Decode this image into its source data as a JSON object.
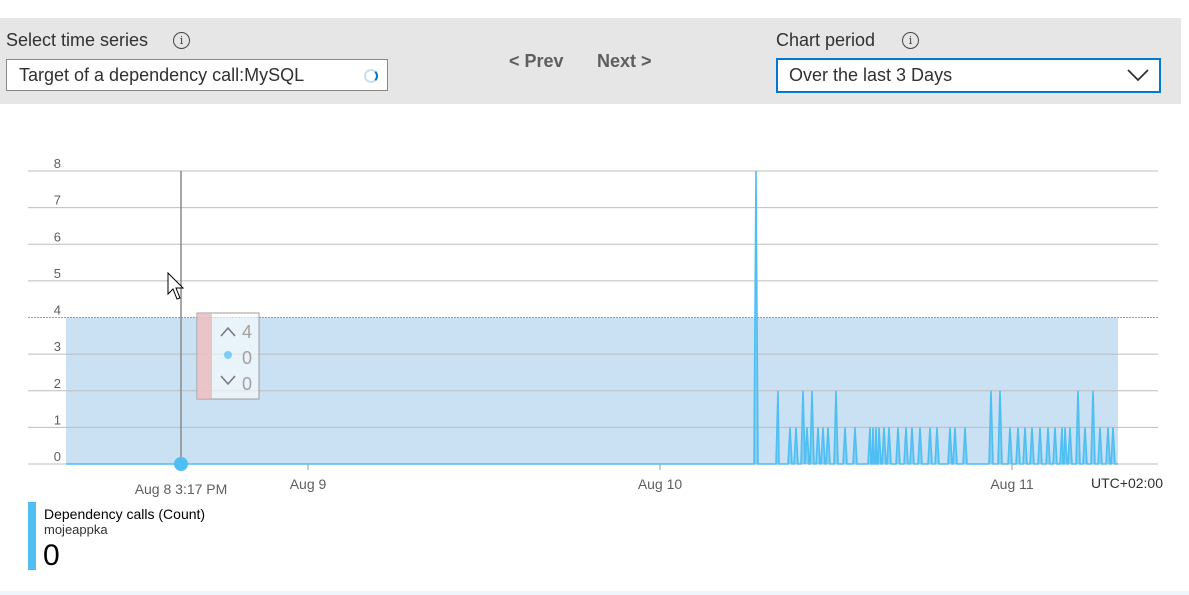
{
  "controls": {
    "series_label": "Select time series",
    "series_value": "Target of a dependency call:MySQL",
    "prev_label": "< Prev",
    "next_label": "Next >",
    "period_label": "Chart period",
    "period_value": "Over the last 3 Days",
    "info_glyph": "i"
  },
  "chart_data": {
    "type": "area",
    "ylim": [
      0,
      8
    ],
    "y_ticks": [
      "8",
      "7",
      "6",
      "5",
      "4",
      "3",
      "2",
      "1",
      "0"
    ],
    "x_ticks": [
      "Aug 9",
      "Aug 10",
      "Aug 11"
    ],
    "hover_time_label": "Aug 8 3:17 PM",
    "timezone_label": "UTC+02:00",
    "band": {
      "upper": 4,
      "lower": 0,
      "color": "#c9e1f2"
    },
    "series_color": "#4fbef2",
    "spike": {
      "value": 8
    },
    "grid": true,
    "tooltip": {
      "upper": "4",
      "mean": "0",
      "lower": "0"
    }
  },
  "legend": {
    "title": "Dependency calls (Count)",
    "subtitle": "mojeappka",
    "value": "0",
    "color": "#4fbef2"
  }
}
